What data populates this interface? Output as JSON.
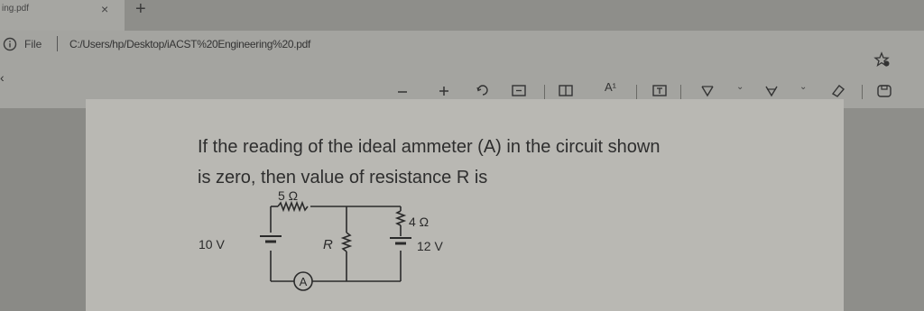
{
  "tab": {
    "title": "ing.pdf",
    "close_glyph": "×",
    "new_tab_glyph": "+"
  },
  "address": {
    "file_label": "File",
    "url": "C:/Users/hp/Desktop/iACST%20Engineering%20.pdf"
  },
  "icons": {
    "info": "info-icon",
    "favorite": "favorite-icon",
    "back": "chevron-left-icon",
    "zoom_out": "minus-icon",
    "zoom_in": "plus-icon",
    "rotate": "rotate-icon",
    "fit": "fit-page-icon",
    "two_page": "two-page-icon",
    "read_aloud": "read-aloud-icon",
    "text_box": "text-box-icon",
    "draw": "draw-icon",
    "highlight": "highlight-icon",
    "erase": "eraser-icon",
    "save": "save-icon"
  },
  "toolbar": {
    "read_aloud_label": "A¹"
  },
  "question": {
    "line1": "If the reading of the ideal ammeter (A) in the circuit shown",
    "line2": "is zero, then value of resistance R is"
  },
  "circuit": {
    "top_resistor_label": "5 Ω",
    "left_battery_label": "10 V",
    "middle_resistor_label": "R",
    "right_resistor_label": "4 Ω",
    "right_battery_label": "12 V",
    "ammeter_label": "A"
  }
}
